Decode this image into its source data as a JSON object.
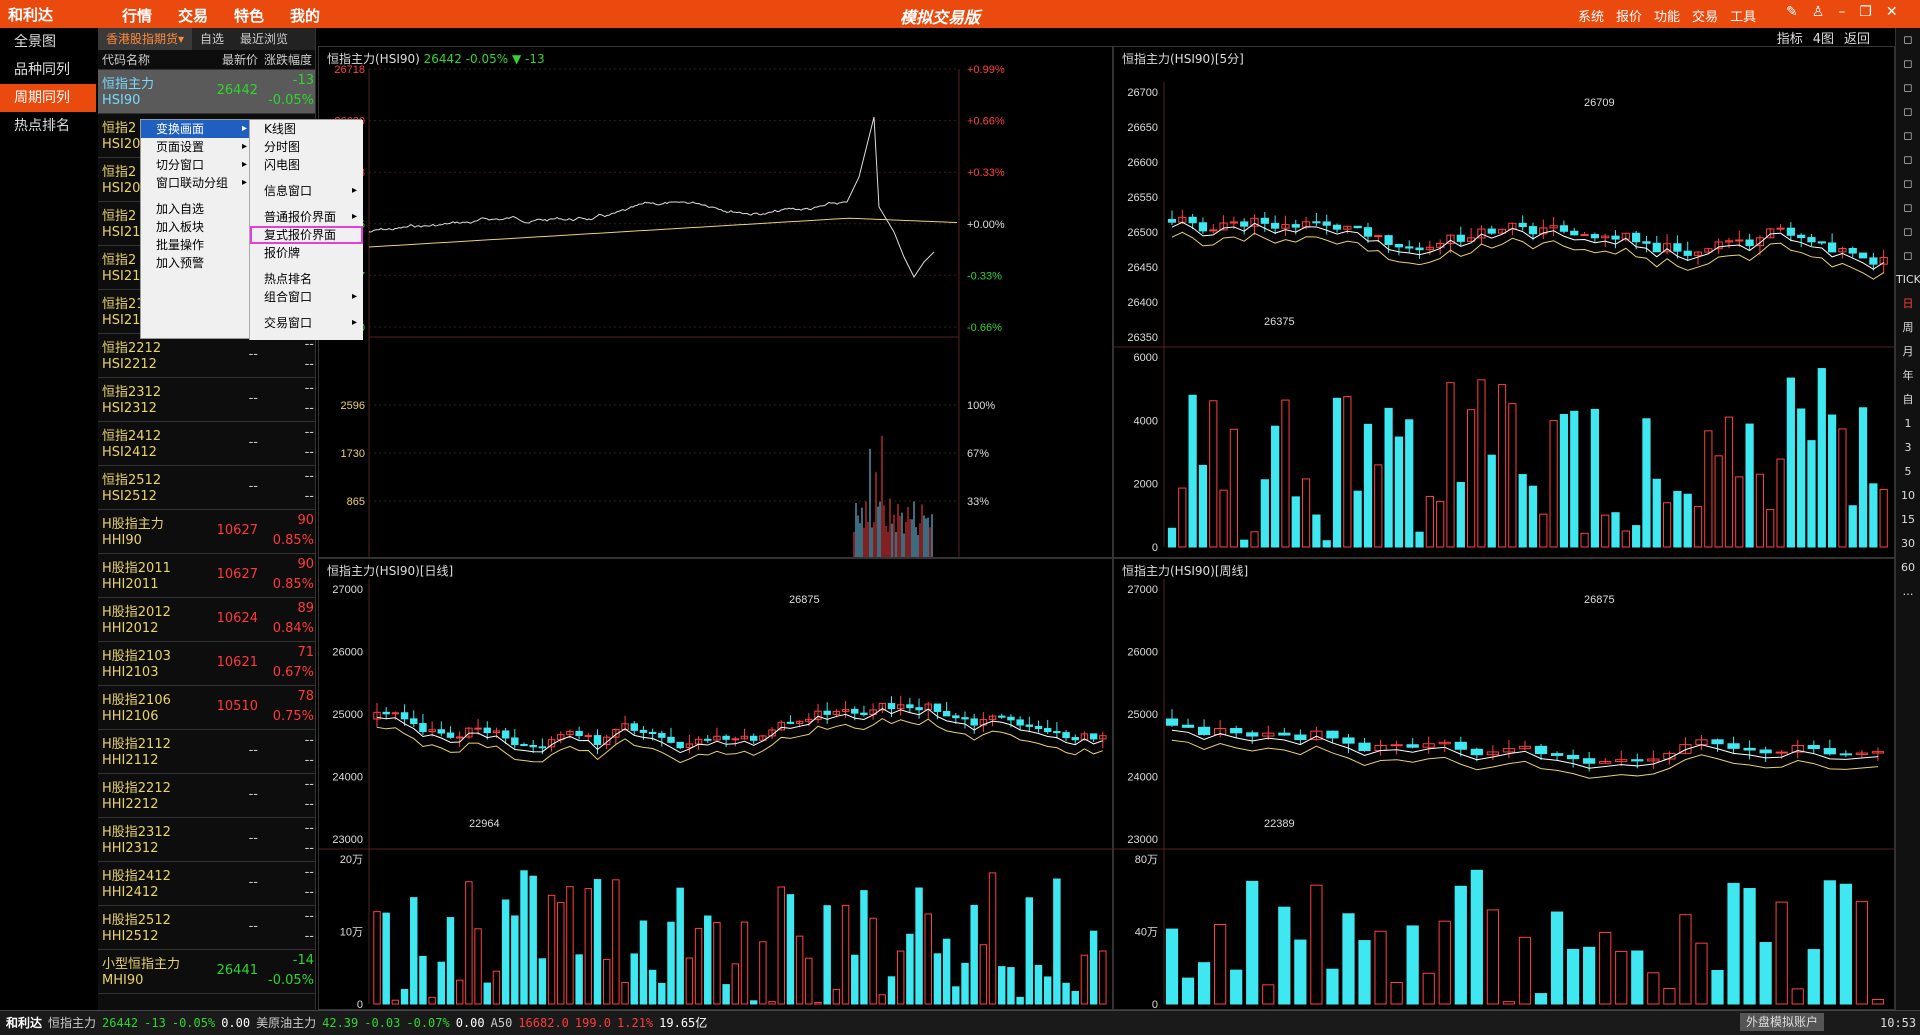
{
  "app": {
    "logo": "和利达",
    "center_title": "模拟交易版",
    "nav": [
      "行情",
      "交易",
      "特色",
      "我的"
    ],
    "menu": [
      "系统",
      "报价",
      "功能",
      "交易",
      "工具"
    ]
  },
  "leftnav": [
    "全景图",
    "品种同列",
    "周期同列",
    "热点排名"
  ],
  "quotelist": {
    "tabs": [
      "香港股指期货▾",
      "自选",
      "最近浏览"
    ],
    "headers": [
      "代码名称",
      "最新价",
      "涨跌幅度"
    ],
    "rows": [
      {
        "name": "恒指主力",
        "code": "HSI90",
        "price": "26442",
        "chg": "-13",
        "pct": "-0.05%",
        "dir": "dn"
      },
      {
        "name": "恒指2",
        "code": "HSI20",
        "price": "",
        "chg": "",
        "pct": "",
        "dir": "fl"
      },
      {
        "name": "恒指2",
        "code": "HSI20",
        "price": "",
        "chg": "",
        "pct": "",
        "dir": "fl"
      },
      {
        "name": "恒指2",
        "code": "HSI21",
        "price": "",
        "chg": "",
        "pct": "",
        "dir": "fl"
      },
      {
        "name": "恒指2",
        "code": "HSI2106",
        "price": "",
        "chg": "",
        "pct": "",
        "dir": "fl"
      },
      {
        "name": "恒指2112",
        "code": "HSI2112",
        "price": "",
        "chg": "",
        "pct": "",
        "dir": "fl"
      },
      {
        "name": "恒指2212",
        "code": "HSI2212",
        "price": "--",
        "chg": "--",
        "pct": "--",
        "dir": "fl"
      },
      {
        "name": "恒指2312",
        "code": "HSI2312",
        "price": "--",
        "chg": "--",
        "pct": "--",
        "dir": "fl"
      },
      {
        "name": "恒指2412",
        "code": "HSI2412",
        "price": "--",
        "chg": "--",
        "pct": "--",
        "dir": "fl"
      },
      {
        "name": "恒指2512",
        "code": "HSI2512",
        "price": "--",
        "chg": "--",
        "pct": "--",
        "dir": "fl"
      },
      {
        "name": "H股指主力",
        "code": "HHI90",
        "price": "10627",
        "chg": "90",
        "pct": "0.85%",
        "dir": "up"
      },
      {
        "name": "H股指2011",
        "code": "HHI2011",
        "price": "10627",
        "chg": "90",
        "pct": "0.85%",
        "dir": "up"
      },
      {
        "name": "H股指2012",
        "code": "HHI2012",
        "price": "10624",
        "chg": "89",
        "pct": "0.84%",
        "dir": "up"
      },
      {
        "name": "H股指2103",
        "code": "HHI2103",
        "price": "10621",
        "chg": "71",
        "pct": "0.67%",
        "dir": "up"
      },
      {
        "name": "H股指2106",
        "code": "HHI2106",
        "price": "10510",
        "chg": "78",
        "pct": "0.75%",
        "dir": "up"
      },
      {
        "name": "H股指2112",
        "code": "HHI2112",
        "price": "--",
        "chg": "--",
        "pct": "--",
        "dir": "fl"
      },
      {
        "name": "H股指2212",
        "code": "HHI2212",
        "price": "--",
        "chg": "--",
        "pct": "--",
        "dir": "fl"
      },
      {
        "name": "H股指2312",
        "code": "HHI2312",
        "price": "--",
        "chg": "--",
        "pct": "--",
        "dir": "fl"
      },
      {
        "name": "H股指2412",
        "code": "HHI2412",
        "price": "--",
        "chg": "--",
        "pct": "--",
        "dir": "fl"
      },
      {
        "name": "H股指2512",
        "code": "HHI2512",
        "price": "--",
        "chg": "--",
        "pct": "--",
        "dir": "fl"
      },
      {
        "name": "小型恒指主力",
        "code": "MHI90",
        "price": "26441",
        "chg": "-14",
        "pct": "-0.05%",
        "dir": "dn"
      }
    ]
  },
  "context_menu": {
    "main": [
      "变换画面",
      "页面设置",
      "切分窗口",
      "窗口联动分组",
      "",
      "加入自选",
      "加入板块",
      "批量操作",
      "加入预警"
    ],
    "sub": [
      "K线图",
      "分时图",
      "闪电图",
      "",
      "信息窗口",
      "",
      "普通报价界面",
      "复式报价界面",
      "报价牌",
      "",
      "热点排名",
      "组合窗口",
      "",
      "交易窗口"
    ]
  },
  "panels": {
    "p1": {
      "title": "恒指主力(HSI90)",
      "price": "26442",
      "chg": "-0.05%",
      "diff": "▼ -13",
      "left_ticks": [
        "26718",
        "26630",
        "26543",
        "26455",
        "26367",
        "26280",
        "2596",
        "1730",
        "865"
      ],
      "right_ticks": [
        "+0.99%",
        "+0.66%",
        "+0.33%",
        "+0.00%",
        "-0.33%",
        "-0.66%",
        "100%",
        "67%",
        "33%"
      ]
    },
    "p2": {
      "title": "恒指主力(HSI90)[5分]",
      "yticks": [
        "26700",
        "26650",
        "26600",
        "26550",
        "26500",
        "26450",
        "26400",
        "26350"
      ],
      "vticks": [
        "6000",
        "4000",
        "2000",
        "0"
      ],
      "hi": "26709",
      "lo": "26375"
    },
    "p3": {
      "title": "恒指主力(HSI90)[日线]",
      "yticks": [
        "27000",
        "26000",
        "25000",
        "24000",
        "23000"
      ],
      "vticks": [
        "20万",
        "10万",
        "0"
      ],
      "hi": "26875",
      "lo": "22964"
    },
    "p4": {
      "title": "恒指主力(HSI90)[周线]",
      "yticks": [
        "27000",
        "26000",
        "25000",
        "24000",
        "23000"
      ],
      "vticks": [
        "80万",
        "40万",
        "0"
      ],
      "hi": "26875",
      "lo": "22389"
    }
  },
  "toolbar_top": [
    "指标",
    "4图",
    "返回"
  ],
  "righttb": [
    "TICK",
    "日",
    "周",
    "月",
    "年",
    "自",
    "1",
    "3",
    "5",
    "10",
    "15",
    "30",
    "60",
    "…"
  ],
  "status": {
    "s1": "和利达",
    "items": [
      {
        "t": "恒指主力",
        "c": "#ccc"
      },
      {
        "t": "26442",
        "c": "#2fd52f"
      },
      {
        "t": "-13",
        "c": "#2fd52f"
      },
      {
        "t": "-0.05%",
        "c": "#2fd52f"
      },
      {
        "t": "0.00",
        "c": "#fff"
      },
      {
        "t": "美原油主力",
        "c": "#ccc"
      },
      {
        "t": "42.39",
        "c": "#2fd52f"
      },
      {
        "t": "-0.03",
        "c": "#2fd52f"
      },
      {
        "t": "-0.07%",
        "c": "#2fd52f"
      },
      {
        "t": "0.00",
        "c": "#fff"
      },
      {
        "t": "A50",
        "c": "#ccc"
      },
      {
        "t": "16682.0",
        "c": "#ff3a3a"
      },
      {
        "t": "199.0",
        "c": "#ff3a3a"
      },
      {
        "t": "1.21%",
        "c": "#ff3a3a"
      },
      {
        "t": "19.65亿",
        "c": "#fff"
      }
    ],
    "acct": "外盘模拟账户",
    "time": "10:53"
  }
}
